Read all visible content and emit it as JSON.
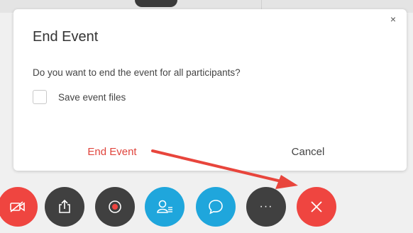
{
  "dialog": {
    "title": "End Event",
    "question": "Do you want to end the event for all participants?",
    "checkbox_label": "Save event files",
    "checkbox_checked": false,
    "end_button_label": "End Event",
    "cancel_button_label": "Cancel",
    "close_glyph": "×"
  },
  "toolbar": {
    "more_glyph": "···",
    "buttons": [
      {
        "icon": "video-off-icon",
        "color": "#ef4540"
      },
      {
        "icon": "share-icon",
        "color": "#404040"
      },
      {
        "icon": "record-icon",
        "color": "#404040"
      },
      {
        "icon": "participants-icon",
        "color": "#1fa6dc"
      },
      {
        "icon": "chat-icon",
        "color": "#1fa6dc"
      },
      {
        "icon": "more-icon",
        "color": "#404040"
      },
      {
        "icon": "end-event-icon",
        "color": "#ef4540"
      }
    ]
  },
  "colors": {
    "accent_red": "#e0443c",
    "annotation_arrow": "#e8453c"
  }
}
